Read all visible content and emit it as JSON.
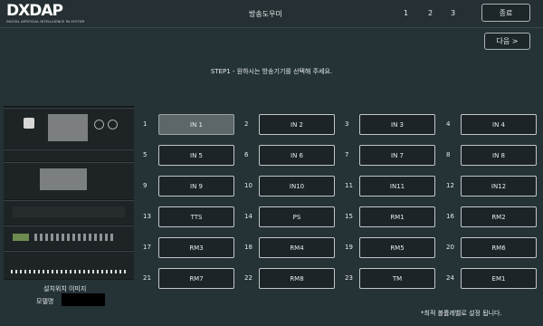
{
  "header": {
    "logo_text": "DXDAP",
    "logo_subtext": "DIGITAL ARTIFICIAL INTELLIGENCE PA SYSTEM",
    "title": "방송도우미",
    "steps": [
      "1",
      "2",
      "3"
    ],
    "close_label": "종료"
  },
  "next_label": "다음 >",
  "instruction": "STEP1 - 원하시는 방송기기를 선택해 주세요.",
  "device": {
    "install_label": "설치위치 이미지",
    "model_label": "모델명"
  },
  "channels": [
    {
      "num": "1",
      "label": "IN 1",
      "selected": true
    },
    {
      "num": "2",
      "label": "IN 2"
    },
    {
      "num": "3",
      "label": "IN 3"
    },
    {
      "num": "4",
      "label": "IN 4"
    },
    {
      "num": "5",
      "label": "IN 5"
    },
    {
      "num": "6",
      "label": "IN 6"
    },
    {
      "num": "7",
      "label": "IN 7"
    },
    {
      "num": "8",
      "label": "IN 8"
    },
    {
      "num": "9",
      "label": "IN 9"
    },
    {
      "num": "10",
      "label": "IN10"
    },
    {
      "num": "11",
      "label": "IN11"
    },
    {
      "num": "12",
      "label": "IN12"
    },
    {
      "num": "13",
      "label": "TTS"
    },
    {
      "num": "14",
      "label": "PS"
    },
    {
      "num": "15",
      "label": "RM1"
    },
    {
      "num": "16",
      "label": "RM2"
    },
    {
      "num": "17",
      "label": "RM3"
    },
    {
      "num": "18",
      "label": "RM4"
    },
    {
      "num": "19",
      "label": "RM5"
    },
    {
      "num": "20",
      "label": "RM6"
    },
    {
      "num": "21",
      "label": "RM7"
    },
    {
      "num": "22",
      "label": "RM8"
    },
    {
      "num": "23",
      "label": "TM"
    },
    {
      "num": "24",
      "label": "EM1"
    }
  ],
  "footnote": "*최적 볼륨레벨로 설정 됩니다."
}
